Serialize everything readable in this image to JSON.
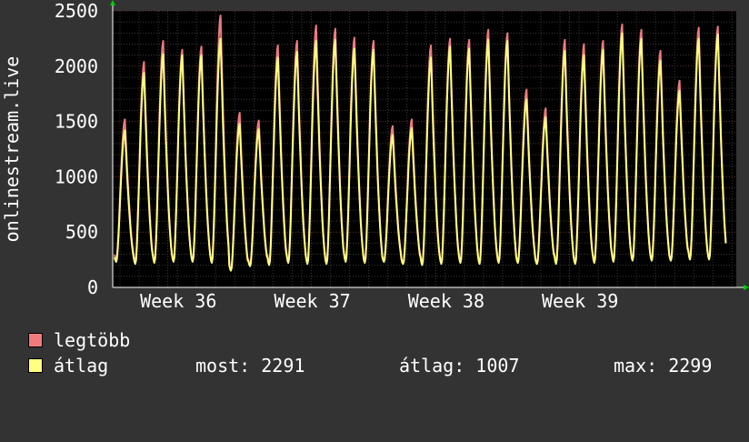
{
  "chart_data": {
    "type": "line",
    "ylabel": "onlinestream.live",
    "ylim": [
      0,
      2500
    ],
    "yticks": [
      0,
      500,
      1000,
      1500,
      2000,
      2500
    ],
    "week_labels": [
      "Week 36",
      "Week 37",
      "Week 38",
      "Week 39"
    ],
    "grid": true,
    "series": [
      {
        "name": "legtöbb",
        "color": "#f07a7e",
        "daily_peaks": [
          1520,
          2040,
          2230,
          2150,
          2180,
          2460,
          1580,
          1510,
          2190,
          2230,
          2370,
          2340,
          2260,
          2230,
          1460,
          1520,
          2190,
          2250,
          2240,
          2330,
          2300,
          1790,
          1620,
          2240,
          2200,
          2230,
          2380,
          2330,
          2140,
          1870,
          2350,
          2360
        ],
        "daily_mins": [
          250,
          230,
          230,
          240,
          240,
          230,
          160,
          200,
          220,
          230,
          220,
          220,
          240,
          230,
          240,
          220,
          210,
          220,
          230,
          220,
          230,
          230,
          220,
          220,
          220,
          230,
          240,
          250,
          250,
          250,
          260,
          260
        ]
      },
      {
        "name": "átlag",
        "color": "#ffff80",
        "daily_peaks": [
          1420,
          1940,
          2110,
          2100,
          2100,
          2250,
          1480,
          1430,
          2080,
          2130,
          2230,
          2240,
          2160,
          2150,
          1380,
          1440,
          2080,
          2180,
          2160,
          2240,
          2230,
          1700,
          1540,
          2140,
          2100,
          2150,
          2300,
          2250,
          2050,
          1780,
          2250,
          2291
        ],
        "daily_mins": [
          230,
          210,
          220,
          230,
          230,
          220,
          150,
          190,
          200,
          220,
          210,
          210,
          230,
          220,
          230,
          210,
          200,
          210,
          220,
          210,
          220,
          220,
          210,
          210,
          210,
          220,
          230,
          240,
          240,
          240,
          250,
          250
        ]
      }
    ]
  },
  "legend": {
    "max_label": "legtöbb",
    "avg_label": "átlag",
    "max_color": "#f07a7e",
    "avg_color": "#ffff80"
  },
  "stats": {
    "now": "most: 2291",
    "avg": "átlag: 1007",
    "max": "max: 2299"
  }
}
